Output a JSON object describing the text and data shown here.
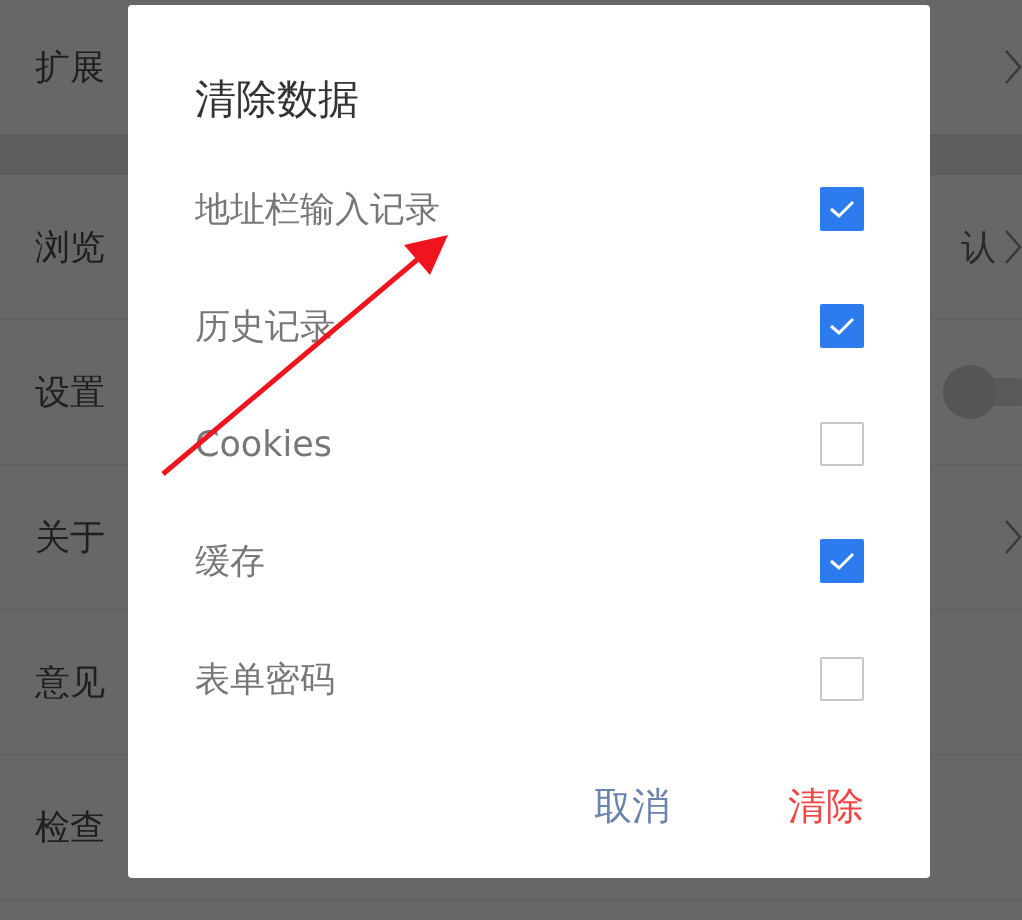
{
  "settings": {
    "groups": [
      {
        "rows": [
          {
            "kind": "chevron",
            "label": "扩展"
          }
        ]
      },
      {
        "rows": [
          {
            "kind": "value",
            "label": "浏览",
            "value": "认"
          },
          {
            "kind": "switch",
            "label": "设置",
            "on": false
          },
          {
            "kind": "chevron",
            "label": "关于"
          },
          {
            "kind": "plain",
            "label": "意见"
          },
          {
            "kind": "plain",
            "label": "检查"
          }
        ]
      }
    ]
  },
  "dialog": {
    "title": "清除数据",
    "options": [
      {
        "label": "地址栏输入记录",
        "checked": true
      },
      {
        "label": "历史记录",
        "checked": true
      },
      {
        "label": "Cookies",
        "checked": false
      },
      {
        "label": "缓存",
        "checked": true
      },
      {
        "label": "表单密码",
        "checked": false
      }
    ],
    "buttons": [
      {
        "kind": "cancel",
        "label": "取消"
      },
      {
        "kind": "confirm",
        "label": "清除"
      }
    ]
  }
}
